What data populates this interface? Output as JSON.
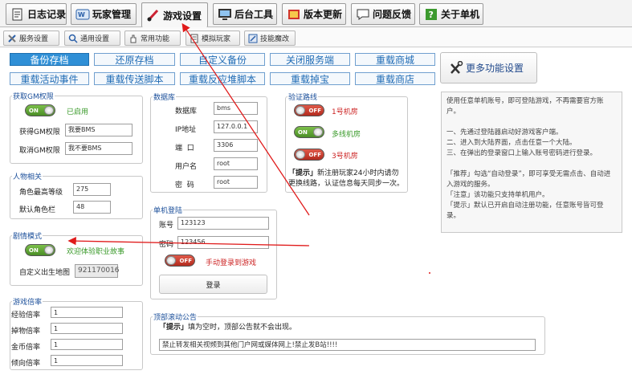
{
  "top_tabs": [
    {
      "label": "日志记录",
      "icon": "notepad-icon"
    },
    {
      "label": "玩家管理",
      "icon": "user-card-icon"
    },
    {
      "label": "游戏设置",
      "icon": "brush-icon"
    },
    {
      "label": "后台工具",
      "icon": "monitor-icon"
    },
    {
      "label": "版本更新",
      "icon": "book-icon"
    },
    {
      "label": "问题反馈",
      "icon": "chat-icon"
    },
    {
      "label": "关于单机",
      "icon": "question-icon"
    }
  ],
  "sub_tabs": [
    {
      "label": "服务设置"
    },
    {
      "label": "通用设置"
    },
    {
      "label": "常用功能"
    },
    {
      "label": "模拟玩家"
    },
    {
      "label": "技能魔改"
    }
  ],
  "actions": {
    "row1": [
      "备份存档",
      "还原存档",
      "自定义备份",
      "关闭服务端",
      "重载商城"
    ],
    "row2": [
      "重载活动事件",
      "重载传送脚本",
      "重载反应堆脚本",
      "重载掉宝",
      "重载商店"
    ],
    "more": "更多功能设置"
  },
  "gm": {
    "title": "获取GM权限",
    "toggle": "ON",
    "status": "已启用",
    "get_label": "获得GM权限",
    "get_value": "我要BMS",
    "cancel_label": "取消GM权限",
    "cancel_value": "我不要BMS"
  },
  "char": {
    "title": "人物相关",
    "max_level_label": "角色最高等级",
    "max_level": "275",
    "slots_label": "默认角色栏",
    "slots": "48"
  },
  "story": {
    "title": "剧情模式",
    "toggle": "ON",
    "status": "欢迎体验职业故事",
    "map_label": "自定义出生地图",
    "map_value": "921170016"
  },
  "rates": {
    "title": "游戏倍率",
    "items": [
      {
        "label": "经验倍率",
        "value": "1"
      },
      {
        "label": "掉物倍率",
        "value": "1"
      },
      {
        "label": "金币倍率",
        "value": "1"
      },
      {
        "label": "倾向倍率",
        "value": "1"
      }
    ]
  },
  "db": {
    "title": "数据库",
    "items": [
      {
        "label": "数据库",
        "value": "bms"
      },
      {
        "label": "IP地址",
        "value": "127.0.0.1"
      },
      {
        "label": "端  口",
        "value": "3306"
      },
      {
        "label": "用户名",
        "value": "root"
      },
      {
        "label": "密  码",
        "value": "root"
      }
    ]
  },
  "route": {
    "title": "验证路线",
    "items": [
      {
        "toggle": "OFF",
        "label": "1号机房"
      },
      {
        "toggle": "ON",
        "label": "多线机房"
      },
      {
        "toggle": "OFF",
        "label": "3号机房"
      }
    ],
    "tip_bold": "「提示」",
    "tip": "新注册玩家24小时内请勿更换线路，认证信息每天同步一次。"
  },
  "login": {
    "title": "单机登陆",
    "account_label": "账号",
    "account": "123123",
    "password_label": "密码",
    "password": "123456",
    "toggle": "OFF",
    "auto_label": "手动登录到游戏",
    "button": "登录"
  },
  "notice": {
    "title": "顶部滚动公告",
    "tip_bold": "「提示」",
    "tip": "填为空时，顶部公告就不会出现。",
    "value": "禁止转发相关视频到其他门户网或媒体网上!禁止发B站!!!!"
  },
  "info": "使用任意单机账号，即可登陆游戏，不再需要官方账户。\n\n一、先通过登陆器启动好游戏客户端。\n二、进入到大陆界面，点击任意一个大陆。\n三、在弹出的登录窗口上输入账号密码进行登录。\n\n「推荐」勾选“自动登录”，即可享受无需点击、自动进入游戏的服务。\n「注意」该功能只支持单机用户。\n「提示」默认已开启自动注册功能，任意账号皆可登录。"
}
